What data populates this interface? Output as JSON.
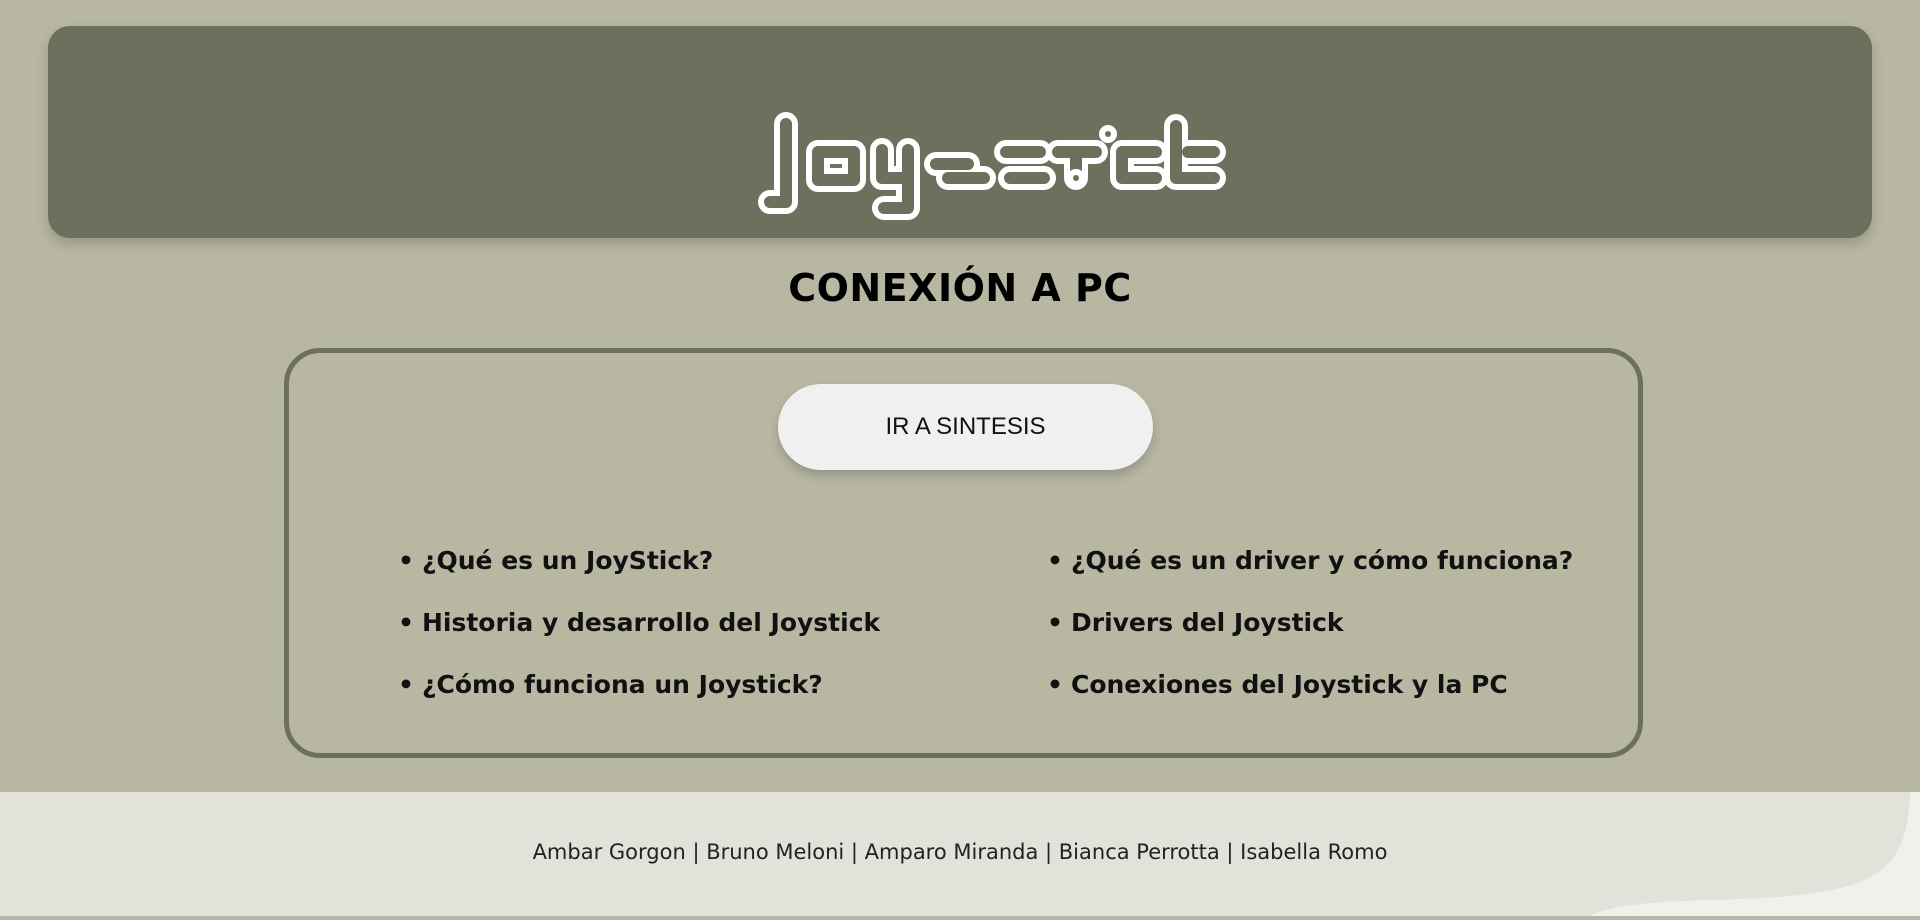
{
  "header": {
    "logo_text": "joystick"
  },
  "page": {
    "title": "CONEXIÓN A PC"
  },
  "index": {
    "synthesis_button_label": "IR A SINTESIS",
    "bullet": "•",
    "left_topics": [
      {
        "label": "¿Qué es un JoyStick?"
      },
      {
        "label": "Historia y desarrollo del Joystick"
      },
      {
        "label": "¿Cómo funciona un Joystick?"
      }
    ],
    "right_topics": [
      {
        "label": "¿Qué es un driver y cómo funciona?"
      },
      {
        "label": "Drivers del Joystick"
      },
      {
        "label": "Conexiones del Joystick y la PC"
      }
    ]
  },
  "footer": {
    "credits": "Ambar Gorgon | Bruno Meloni | Amparo Miranda | Bianca Perrotta | Isabella Romo"
  },
  "colors": {
    "background": "#b7b7a2",
    "banner": "#6b715c",
    "button": "#f0f0f0",
    "footer": "#e2e2db"
  }
}
